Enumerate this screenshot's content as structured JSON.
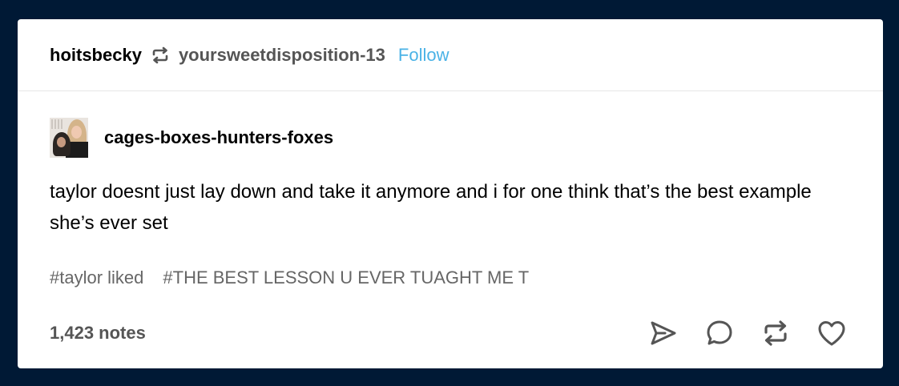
{
  "header": {
    "author": "hoitsbecky",
    "source": "yoursweetdisposition-13",
    "follow_label": "Follow",
    "reblog_icon": "reblog-icon"
  },
  "trail": {
    "blog_name": "cages-boxes-hunters-foxes",
    "text": "taylor doesnt just lay down and take it anymore and i for one think that’s the best example she’s ever set"
  },
  "tags": [
    "#taylor liked",
    "#THE BEST LESSON U EVER TUAGHT ME T"
  ],
  "footer": {
    "notes": "1,423 notes",
    "actions": [
      "share-icon",
      "reply-icon",
      "reblog-icon",
      "like-icon"
    ]
  },
  "colors": {
    "background": "#001935",
    "card": "#ffffff",
    "follow": "#4ab2e6",
    "muted": "#555555",
    "tag": "#666666"
  }
}
